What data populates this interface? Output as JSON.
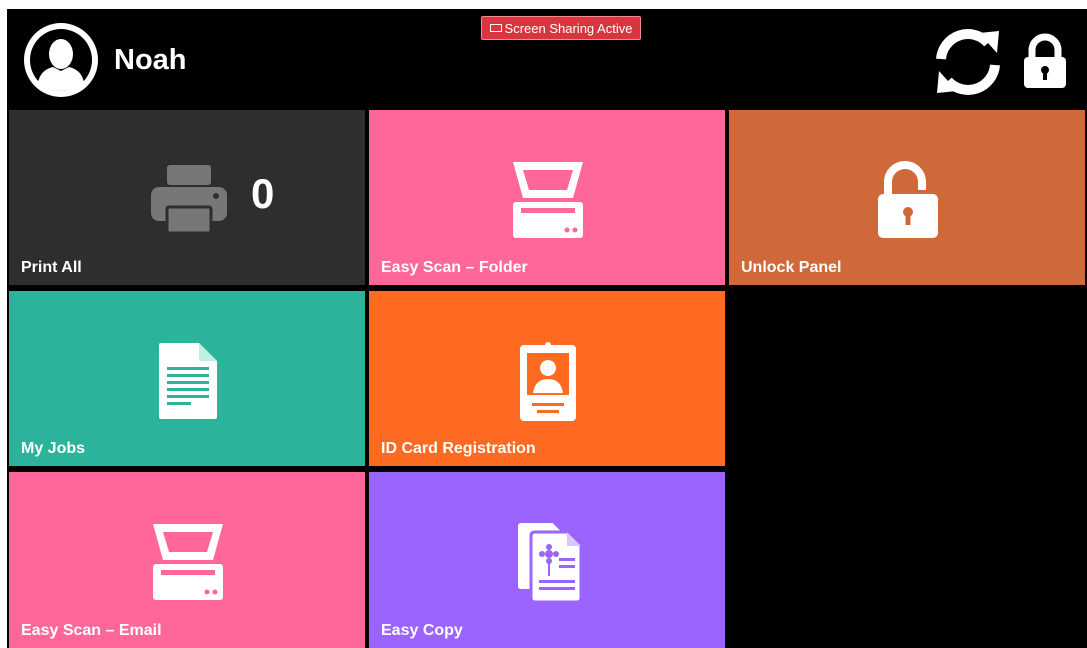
{
  "header": {
    "user_name": "Noah",
    "screen_sharing_label": "Screen Sharing Active",
    "icons": [
      "avatar-icon",
      "refresh-icon",
      "lock-icon"
    ]
  },
  "tiles": [
    {
      "id": "print-all",
      "label": "Print All",
      "count": "0",
      "icon": "printer-icon",
      "color": "#2e2e2e"
    },
    {
      "id": "scan-folder",
      "label": "Easy Scan – Folder",
      "icon": "scanner-icon",
      "color": "#ff6699"
    },
    {
      "id": "unlock",
      "label": "Unlock Panel",
      "icon": "open-lock-icon",
      "color": "#d0693a"
    },
    {
      "id": "my-jobs",
      "label": "My Jobs",
      "icon": "document-icon",
      "color": "#2bb39b"
    },
    {
      "id": "id-card",
      "label": "ID Card Registration",
      "icon": "id-card-icon",
      "color": "#ff6a22"
    },
    {
      "id": "scan-email",
      "label": "Easy Scan – Email",
      "icon": "scanner-icon",
      "color": "#ff6699"
    },
    {
      "id": "easy-copy",
      "label": "Easy Copy",
      "icon": "copy-icon",
      "color": "#9b63ff"
    }
  ]
}
